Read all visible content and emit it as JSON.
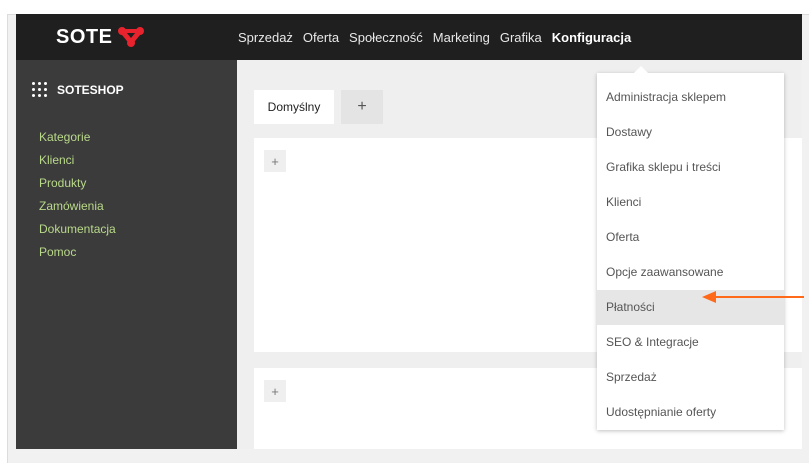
{
  "app": {
    "logo_text": "SOTE",
    "accent_color": "#ff6a1a",
    "logo_icon": "red-connector-icon"
  },
  "topnav": {
    "items": [
      {
        "label": "Sprzedaż"
      },
      {
        "label": "Oferta"
      },
      {
        "label": "Społeczność"
      },
      {
        "label": "Marketing"
      },
      {
        "label": "Grafika"
      },
      {
        "label": "Konfiguracja",
        "active": true
      }
    ]
  },
  "sidebar": {
    "brand": "SOTESHOP",
    "brand_icon": "grid-dots-icon",
    "items": [
      {
        "label": "Kategorie"
      },
      {
        "label": "Klienci"
      },
      {
        "label": "Produkty"
      },
      {
        "label": "Zamówienia"
      },
      {
        "label": "Dokumentacja"
      },
      {
        "label": "Pomoc"
      }
    ]
  },
  "main": {
    "tab_label": "Domyślny",
    "add_symbol": "+"
  },
  "dropdown": {
    "items": [
      {
        "label": "Administracja sklepem"
      },
      {
        "label": "Dostawy"
      },
      {
        "label": "Grafika sklepu i treści"
      },
      {
        "label": "Klienci"
      },
      {
        "label": "Oferta"
      },
      {
        "label": "Opcje zaawansowane"
      },
      {
        "label": "Płatności",
        "highlight": true
      },
      {
        "label": "SEO & Integracje"
      },
      {
        "label": "Sprzedaż"
      },
      {
        "label": "Udostępnianie oferty"
      }
    ]
  }
}
